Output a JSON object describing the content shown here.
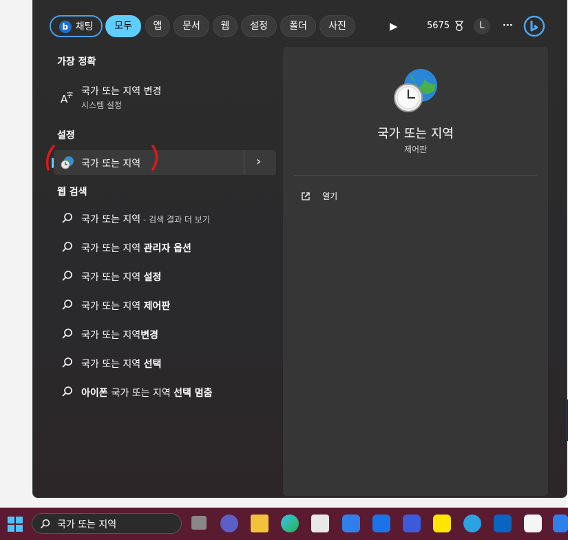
{
  "filters": {
    "chat": "채팅",
    "all": "모두",
    "apps": "앱",
    "documents": "문서",
    "web": "웹",
    "settings": "설정",
    "folders": "폴더",
    "photos": "사진"
  },
  "toolbar": {
    "points": "5675",
    "avatar_letter": "L",
    "more": "···",
    "bing_letter": "b"
  },
  "sections": {
    "best_match": "가장 정확",
    "settings": "설정",
    "web_search": "웹 검색"
  },
  "best_match": {
    "title": "국가 또는 지역 변경",
    "subtitle": "시스템 설정"
  },
  "settings_result": {
    "title": "국가 또는 지역"
  },
  "web_results": [
    {
      "main": "국가 또는 지역",
      "suffix": " - 검색 결과 더 보기"
    },
    {
      "main": "국가 또는 지역 ",
      "bold": "관리자 옵션"
    },
    {
      "main": "국가 또는 지역 ",
      "bold": "설정"
    },
    {
      "main": "국가 또는 지역 ",
      "bold": "제어판"
    },
    {
      "main": "국가 또는 지역",
      "bold": "변경"
    },
    {
      "main": "국가 또는 지역 ",
      "bold": "선택"
    },
    {
      "bold_prefix": "아이폰 ",
      "main": "국가 또는 지역 ",
      "bold": "선택 멈춤"
    }
  ],
  "preview": {
    "title": "국가 또는 지역",
    "subtitle": "제어판",
    "open_label": "열기"
  },
  "taskbar": {
    "search_text": "국가 또는 지역"
  },
  "colors": {
    "accent": "#60cdff",
    "taskbar": "#5a1a30",
    "panel": "#363636",
    "window": "#2c2c2c"
  }
}
